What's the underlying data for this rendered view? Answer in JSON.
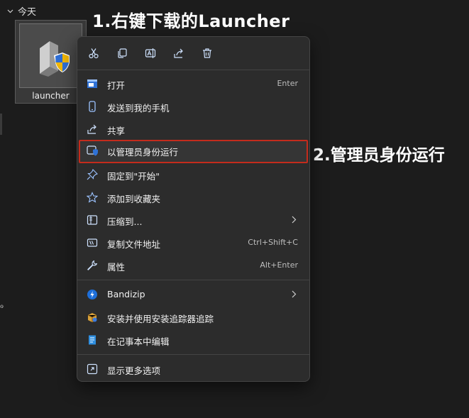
{
  "explorer": {
    "group_header": "今天",
    "file_name": "launcher",
    "stray_char": "ℴ"
  },
  "annotations": {
    "step1": "1.右键下载的Launcher",
    "step2": "2.管理员身份运行"
  },
  "quick_actions": [
    "cut-icon",
    "copy-icon",
    "rename-icon",
    "share-icon",
    "delete-icon"
  ],
  "menu": {
    "open": {
      "label": "打开",
      "shortcut": "Enter"
    },
    "send_to_phone": {
      "label": "发送到我的手机"
    },
    "share": {
      "label": "共享"
    },
    "run_as_admin": {
      "label": "以管理员身份运行"
    },
    "pin_to_start": {
      "label": "固定到\"开始\""
    },
    "add_favorites": {
      "label": "添加到收藏夹"
    },
    "compress": {
      "label": "压缩到..."
    },
    "copy_path": {
      "label": "复制文件地址",
      "shortcut": "Ctrl+Shift+C"
    },
    "properties": {
      "label": "属性",
      "shortcut": "Alt+Enter"
    },
    "bandizip": {
      "label": "Bandizip"
    },
    "install_tracker": {
      "label": "安装并使用安装追踪器追踪"
    },
    "edit_notepad": {
      "label": "在记事本中编辑"
    },
    "more_options": {
      "label": "显示更多选项"
    }
  },
  "colors": {
    "highlight_border": "#c42b1c",
    "menu_bg": "#2c2c2c"
  }
}
